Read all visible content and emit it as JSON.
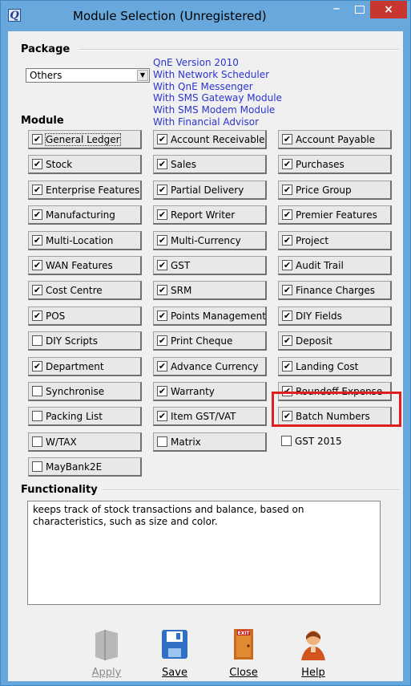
{
  "window": {
    "title": "Module Selection (Unregistered)",
    "minimize_glyph": "–",
    "close_glyph": "×"
  },
  "package": {
    "heading": "Package",
    "selected": "Others",
    "info_lines": [
      "QnE Version 2010",
      "With Network Scheduler",
      "With QnE Messenger",
      "With SMS Gateway Module",
      "With SMS Modem Module",
      "With Financial Advisor"
    ]
  },
  "module": {
    "heading": "Module",
    "items": [
      {
        "label": "General Ledger",
        "checked": true,
        "style": "button"
      },
      {
        "label": "Account Receivable",
        "checked": true,
        "style": "button"
      },
      {
        "label": "Account Payable",
        "checked": true,
        "style": "button"
      },
      {
        "label": "Stock",
        "checked": true,
        "style": "button"
      },
      {
        "label": "Sales",
        "checked": true,
        "style": "button"
      },
      {
        "label": "Purchases",
        "checked": true,
        "style": "button"
      },
      {
        "label": "Enterprise Features",
        "checked": true,
        "style": "button"
      },
      {
        "label": "Partial Delivery",
        "checked": true,
        "style": "button"
      },
      {
        "label": "Price Group",
        "checked": true,
        "style": "button"
      },
      {
        "label": "Manufacturing",
        "checked": true,
        "style": "button"
      },
      {
        "label": "Report Writer",
        "checked": true,
        "style": "button"
      },
      {
        "label": "Premier Features",
        "checked": true,
        "style": "button"
      },
      {
        "label": "Multi-Location",
        "checked": true,
        "style": "button"
      },
      {
        "label": "Multi-Currency",
        "checked": true,
        "style": "button"
      },
      {
        "label": "Project",
        "checked": true,
        "style": "button"
      },
      {
        "label": "WAN Features",
        "checked": true,
        "style": "button"
      },
      {
        "label": "GST",
        "checked": true,
        "style": "button"
      },
      {
        "label": "Audit Trail",
        "checked": true,
        "style": "button"
      },
      {
        "label": "Cost Centre",
        "checked": true,
        "style": "button"
      },
      {
        "label": "SRM",
        "checked": true,
        "style": "button"
      },
      {
        "label": "Finance Charges",
        "checked": true,
        "style": "button"
      },
      {
        "label": "POS",
        "checked": true,
        "style": "button"
      },
      {
        "label": "Points Management",
        "checked": true,
        "style": "button"
      },
      {
        "label": "DIY Fields",
        "checked": true,
        "style": "button"
      },
      {
        "label": "DIY Scripts",
        "checked": false,
        "style": "button"
      },
      {
        "label": "Print Cheque",
        "checked": true,
        "style": "button"
      },
      {
        "label": "Deposit",
        "checked": true,
        "style": "button"
      },
      {
        "label": "Department",
        "checked": true,
        "style": "button"
      },
      {
        "label": "Advance Currency",
        "checked": true,
        "style": "button"
      },
      {
        "label": "Landing Cost",
        "checked": true,
        "style": "button"
      },
      {
        "label": "Synchronise",
        "checked": false,
        "style": "button"
      },
      {
        "label": "Warranty",
        "checked": true,
        "style": "button"
      },
      {
        "label": "Roundoff Expense",
        "checked": true,
        "style": "button"
      },
      {
        "label": "Packing List",
        "checked": false,
        "style": "button"
      },
      {
        "label": "Item GST/VAT",
        "checked": true,
        "style": "button"
      },
      {
        "label": "Batch Numbers",
        "checked": true,
        "style": "button"
      },
      {
        "label": "W/TAX",
        "checked": false,
        "style": "button"
      },
      {
        "label": "Matrix",
        "checked": false,
        "style": "button"
      },
      {
        "label": "GST 2015",
        "checked": false,
        "style": "flat"
      },
      {
        "label": "MayBank2E",
        "checked": false,
        "style": "button"
      }
    ]
  },
  "functionality": {
    "heading": "Functionality",
    "description": "keeps track of stock transactions and balance, based on characteristics, such as size and color."
  },
  "actions": [
    {
      "label": "Apply",
      "icon": "apply-icon",
      "enabled": false
    },
    {
      "label": "Save",
      "icon": "save-disk-icon",
      "enabled": true
    },
    {
      "label": "Close",
      "icon": "exit-door-icon",
      "enabled": true
    },
    {
      "label": "Help",
      "icon": "help-person-icon",
      "enabled": true
    }
  ],
  "highlight_color": "#e0201f",
  "link_color": "#2a35d0"
}
